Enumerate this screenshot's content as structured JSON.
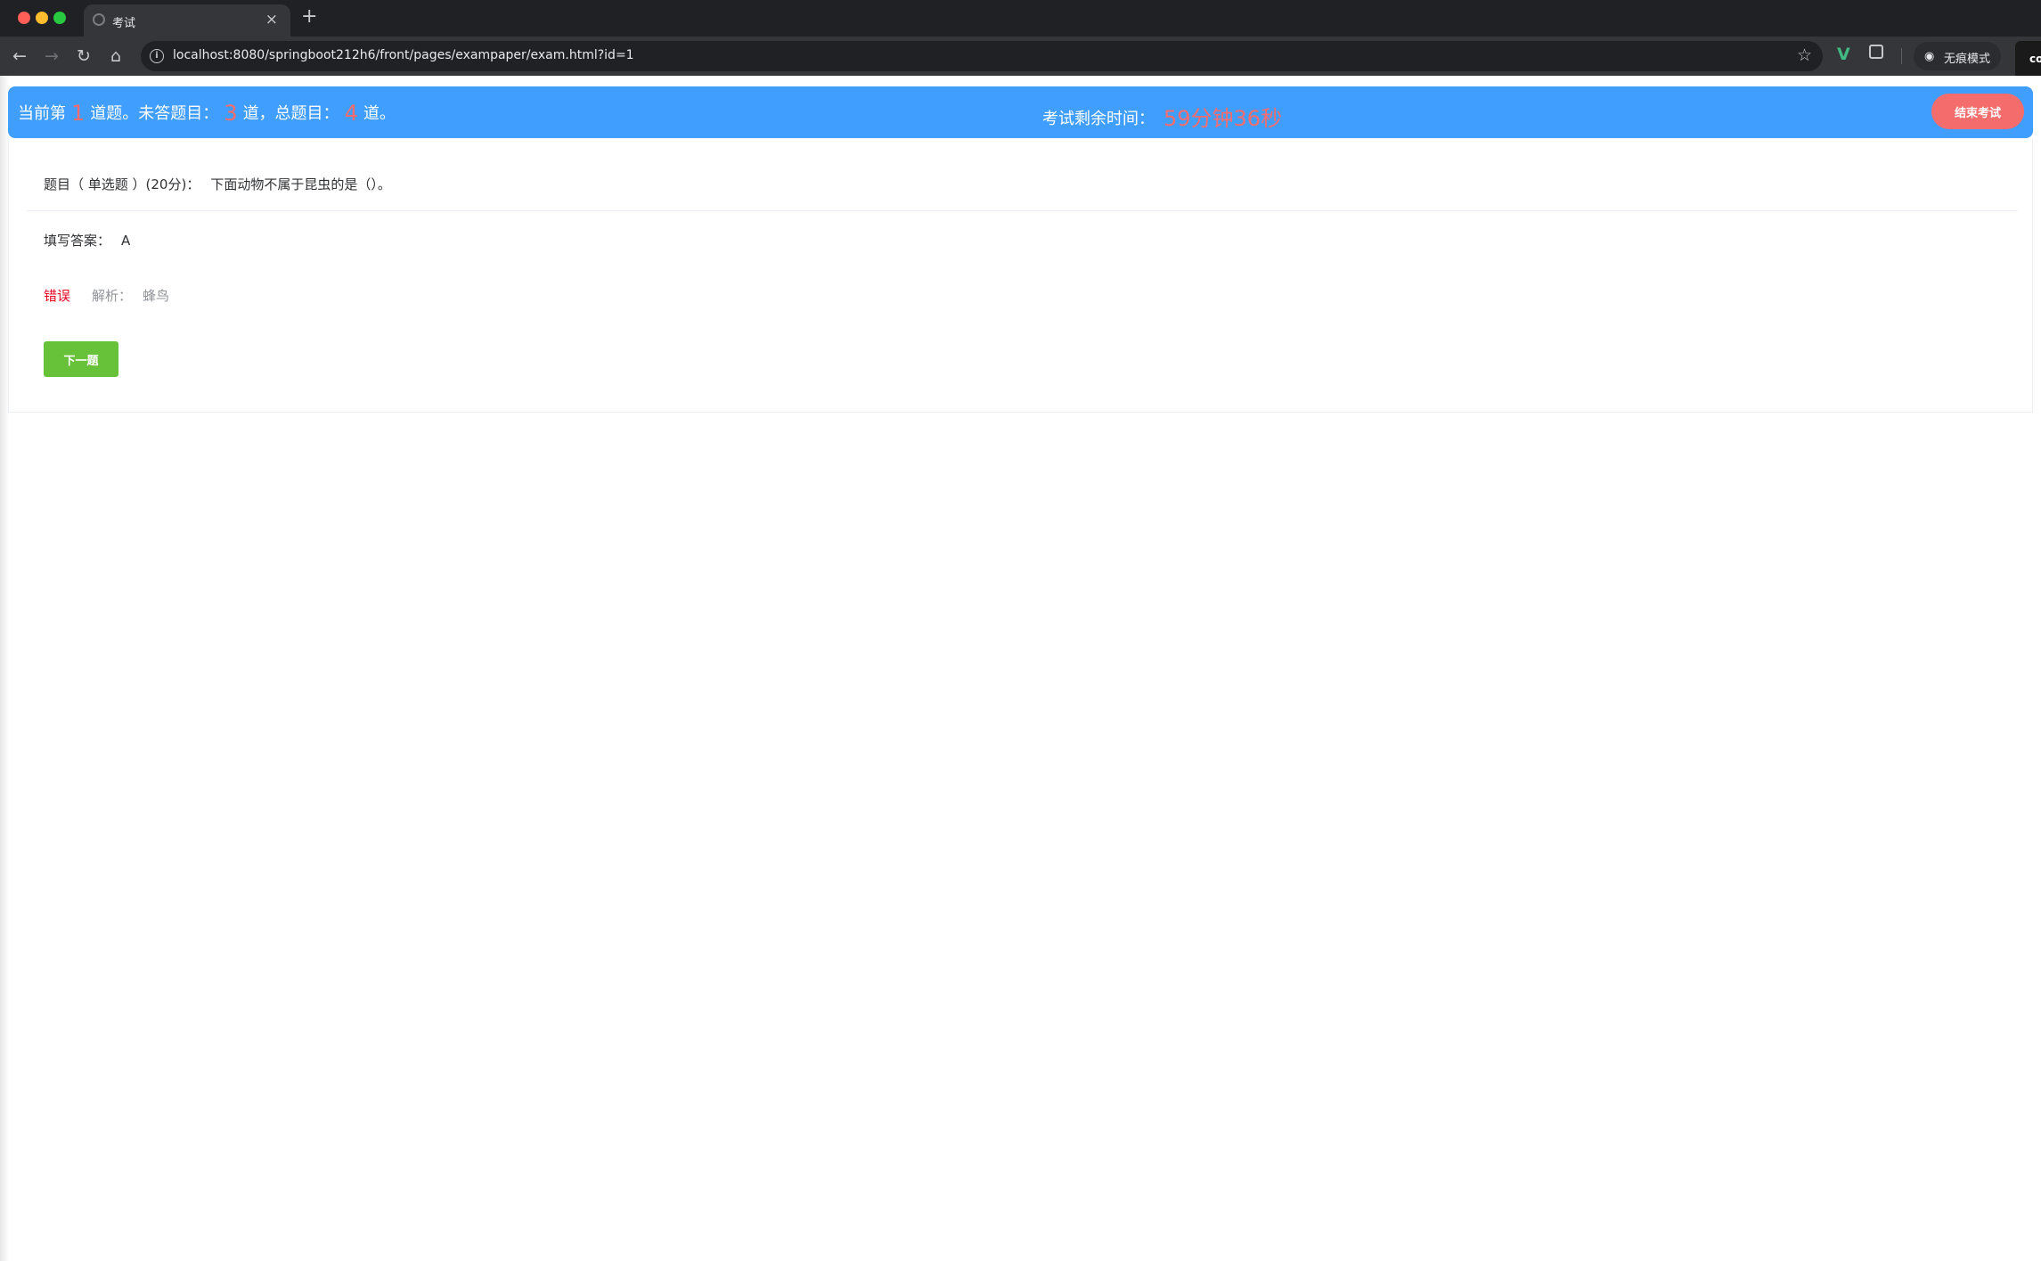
{
  "browser": {
    "tab_title": "考试",
    "tab_close": "×",
    "new_tab": "+",
    "url": "localhost:8080/springboot212h6/front/pages/exampaper/exam.html?id=1",
    "incognito_label": "无痕模式",
    "edge_widget_text": "co"
  },
  "header": {
    "progress_prefix": "当前第",
    "current_index": "1",
    "progress_mid1": "道题。未答题目：",
    "unanswered_count": "3",
    "progress_mid2": "道，总题目：",
    "total_count": "4",
    "progress_suffix": "道。",
    "timer_label": "考试剩余时间：",
    "timer_value": "59分钟36秒",
    "end_button": "结束考试"
  },
  "question": {
    "title_prefix": "题目（ 单选题 ）(20分)：",
    "text": "下面动物不属于昆虫的是（）。",
    "answer_label": "填写答案：",
    "answer_value": "A",
    "result_status": "错误",
    "analysis_label": "解析：",
    "analysis_value": "蜂鸟",
    "next_button": "下一题"
  },
  "colors": {
    "header_bg": "#409eff",
    "highlight_red": "#f56c6c",
    "end_button_bg": "#f56c6c",
    "next_button_bg": "#67c23a",
    "wrong_status": "#e6001f"
  }
}
